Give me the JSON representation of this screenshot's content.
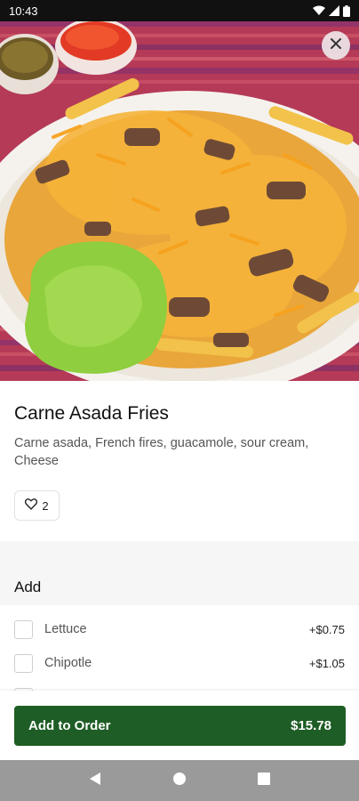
{
  "status_bar": {
    "time": "10:43"
  },
  "item": {
    "title": "Carne Asada Fries",
    "description": "Carne asada, French fires, guacamole, sour cream, Cheese",
    "likes": "2"
  },
  "section": {
    "title": "Add"
  },
  "options": [
    {
      "label": "Lettuce",
      "price": "+$0.75",
      "checked": false
    },
    {
      "label": "Chipotle",
      "price": "+$1.05",
      "checked": false
    },
    {
      "label": "",
      "price": "",
      "checked": false
    }
  ],
  "footer": {
    "button_label": "Add to Order",
    "total": "$15.78"
  },
  "colors": {
    "accent": "#1e5d25",
    "nav_bar": "#9a9a9a"
  },
  "icons": [
    "wifi-icon",
    "signal-icon",
    "battery-icon",
    "close-icon",
    "heart-icon",
    "back-icon",
    "home-icon",
    "recents-icon"
  ]
}
